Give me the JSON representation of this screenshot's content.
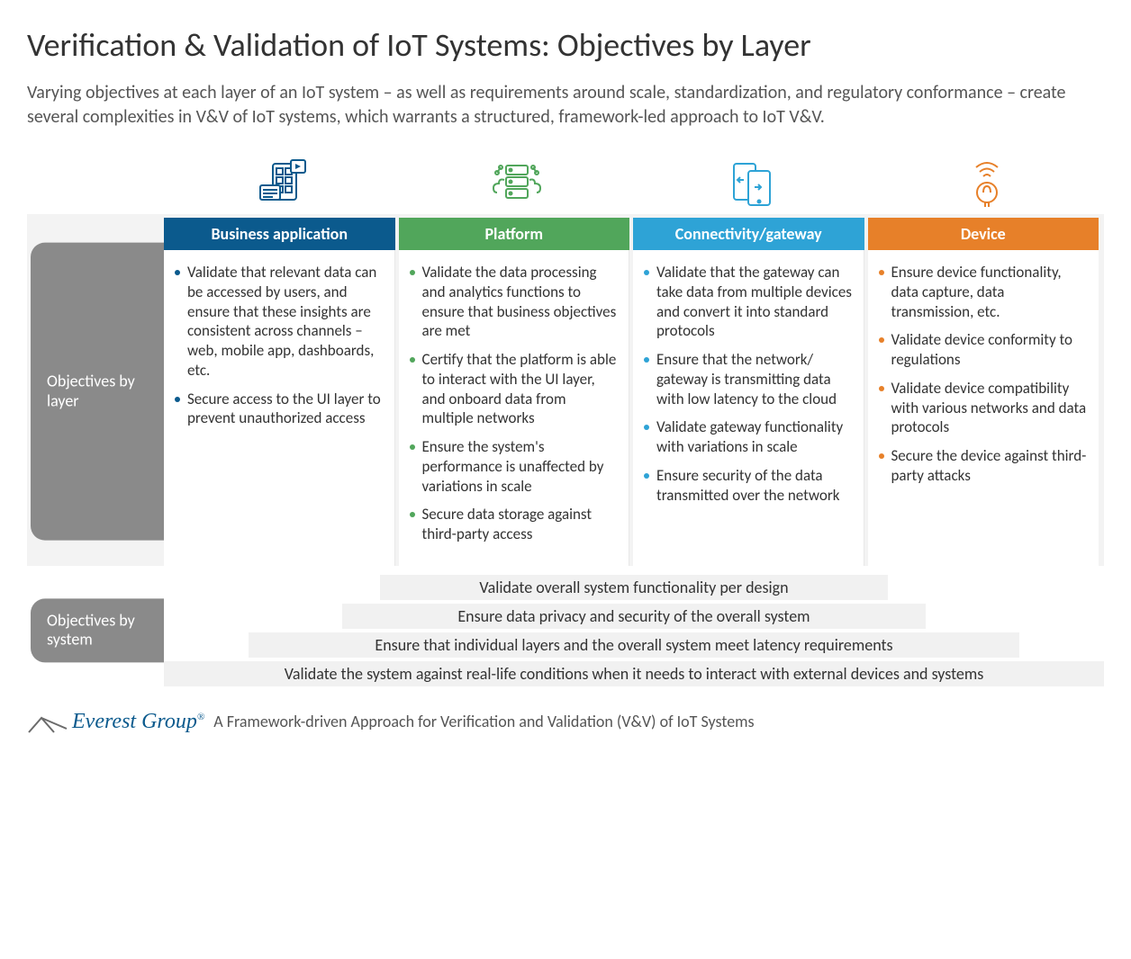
{
  "title": "Verification & Validation of IoT Systems: Objectives by Layer",
  "intro": "Varying objectives at each layer of an IoT system – as well as requirements around scale, standardization, and regulatory conformance – create several complexities in V&V of IoT systems, which warrants a structured, framework-led approach to IoT V&V.",
  "side_labels": {
    "by_layer": "Objectives by layer",
    "by_system": "Objectives by system"
  },
  "columns": [
    {
      "icon": "business-app-icon",
      "header": "Business application",
      "items": [
        "Validate that relevant data can be accessed by users, and ensure that these insights are consistent across channels – web, mobile app, dashboards, etc.",
        "Secure access to the UI layer to prevent unauthorized access"
      ]
    },
    {
      "icon": "platform-icon",
      "header": "Platform",
      "items": [
        "Validate the data processing and analytics functions to ensure that business objectives are met",
        "Certify that the platform is able to interact with the UI layer, and onboard data from multiple networks",
        "Ensure the system's performance is unaffected by variations in scale",
        "Secure data storage against third-party access"
      ]
    },
    {
      "icon": "connectivity-icon",
      "header": "Connectivity/gateway",
      "items": [
        "Validate that the gateway can take data from multiple devices and convert it into standard protocols",
        "Ensure that the network/ gateway is transmitting data with low latency to the cloud",
        "Validate gateway functionality with variations in scale",
        "Ensure security of the data transmitted over the network"
      ]
    },
    {
      "icon": "device-icon",
      "header": "Device",
      "items": [
        "Ensure device functionality, data capture, data transmission, etc.",
        "Validate device conformity to regulations",
        "Validate device compatibility with various networks and data protocols",
        "Secure the device against third-party attacks"
      ]
    }
  ],
  "system_objectives": [
    "Validate overall system functionality per design",
    "Ensure data privacy and security of the overall system",
    "Ensure that individual layers and the overall system meet latency requirements",
    "Validate the system against real-life conditions when it needs to interact with external devices and systems"
  ],
  "footer": {
    "brand": "Everest Group",
    "reg": "®",
    "tagline": "A Framework-driven Approach for Verification and Validation (V&V) of IoT Systems"
  },
  "colors": {
    "c0": "#0b5a8d",
    "c1": "#51a65b",
    "c2": "#2ea3d6",
    "c3": "#e78029"
  }
}
